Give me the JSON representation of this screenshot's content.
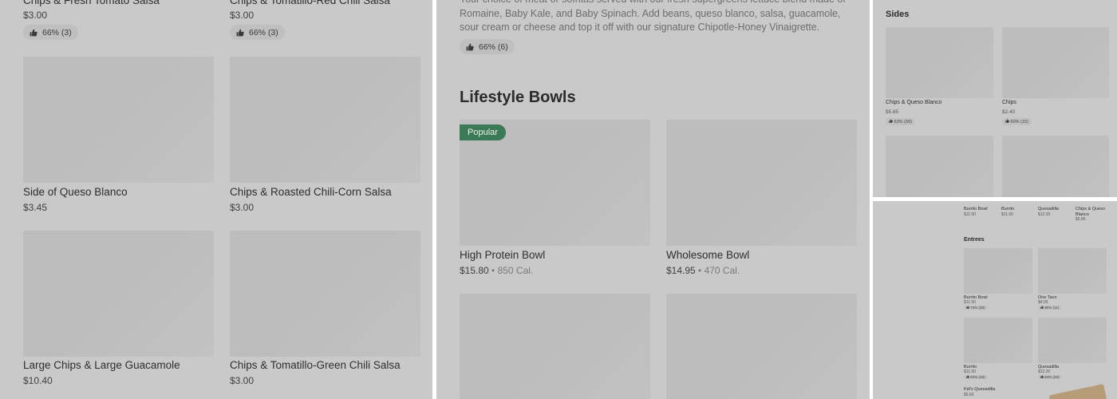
{
  "panel1": {
    "top_items": [
      {
        "name": "Chips & Fresh Tomato Salsa",
        "price": "$3.00",
        "rating": "66% (3)"
      },
      {
        "name": "Chips & Tomatillo-Red Chili Salsa",
        "price": "$3.00",
        "rating": "66% (3)"
      }
    ],
    "items": [
      {
        "name": "Side of Queso Blanco",
        "price": "$3.45"
      },
      {
        "name": "Chips & Roasted Chili-Corn Salsa",
        "price": "$3.00"
      },
      {
        "name": "Large Chips & Large Guacamole",
        "price": "$10.40"
      },
      {
        "name": "Chips & Tomatillo-Green Chili Salsa",
        "price": "$3.00"
      }
    ]
  },
  "panel2": {
    "description": "Your choice of meat or sofritas served with our fresh supergreens lettuce blend made of Romaine, Baby Kale, and Baby Spinach. Add beans, queso blanco, salsa, guacamole, sour cream or cheese and top it off with our signature Chipotle-Honey Vinaigrette.",
    "description_rating": "66% (6)",
    "section_title": "Lifestyle Bowls",
    "badge": "Popular",
    "items": [
      {
        "name": "High Protein Bowl",
        "price": "$15.80",
        "sep": " • ",
        "calories": "850 Cal."
      },
      {
        "name": "Wholesome Bowl",
        "price": "$14.95",
        "sep": " • ",
        "calories": "470 Cal."
      }
    ]
  },
  "panel3": {
    "section_title": "Sides",
    "items": [
      {
        "name": "Chips & Queso Blanco",
        "price": "$5.85",
        "rating": "63% (30)"
      },
      {
        "name": "Chips",
        "price": "$2.40",
        "rating": "60% (15)"
      }
    ]
  },
  "panel4": {
    "top_items": [
      {
        "name": "Burrito Bowl",
        "price": "$11.50"
      },
      {
        "name": "Burrito",
        "price": "$11.50"
      },
      {
        "name": "Quesadilla",
        "price": "$12.20"
      },
      {
        "name": "Chips & Queso Blanco",
        "price": "$5.85"
      }
    ],
    "section_title": "Entrees",
    "items": [
      {
        "name": "Burrito Bowl",
        "price": "$11.50",
        "rating": "73% (30)"
      },
      {
        "name": "One Taco",
        "price": "$4.05",
        "rating": "90% (11)"
      },
      {
        "name": "Burrito",
        "price": "$11.50",
        "rating": "84% (16)"
      },
      {
        "name": "Quesadilla",
        "price": "$12.20",
        "rating": "84% (33)"
      }
    ],
    "bottom_item": {
      "name": "Kid's Quesadilla",
      "price": "$5.60"
    }
  },
  "icons": {
    "rating": "thumbs-up-icon"
  },
  "colors": {
    "badge": "#3b7a57",
    "overlay": "#c9c9c9"
  }
}
